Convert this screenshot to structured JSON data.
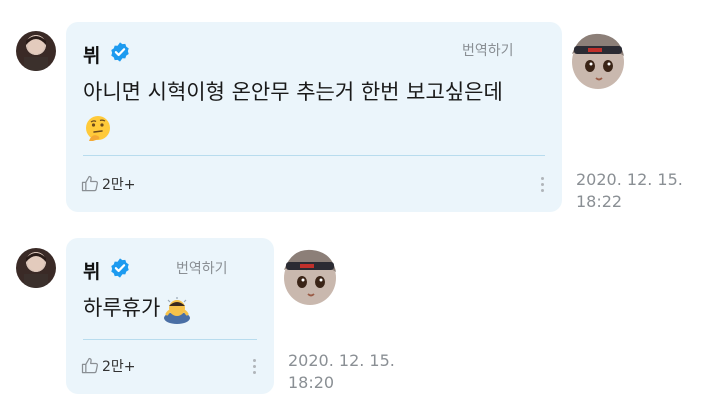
{
  "messages": [
    {
      "sender": "뷔",
      "translate_label": "번역하기",
      "text": "아니면 시혁이형 온안무 추는거 한번 보고싶은데",
      "emoji": "thinking-face",
      "likes": "2만+",
      "date": "2020. 12. 15.",
      "time": "18:22"
    },
    {
      "sender": "뷔",
      "translate_label": "번역하기",
      "text": "하루휴가",
      "emoji": "bowing-person",
      "likes": "2만+",
      "date": "2020. 12. 15.",
      "time": "18:20"
    }
  ],
  "colors": {
    "bubble_bg": "#ebf5fb",
    "verified": "#1d9bf0",
    "timestamp": "#8a8f94"
  },
  "icons": [
    "verified-badge-icon",
    "thumbs-up-icon",
    "more-vertical-icon"
  ]
}
